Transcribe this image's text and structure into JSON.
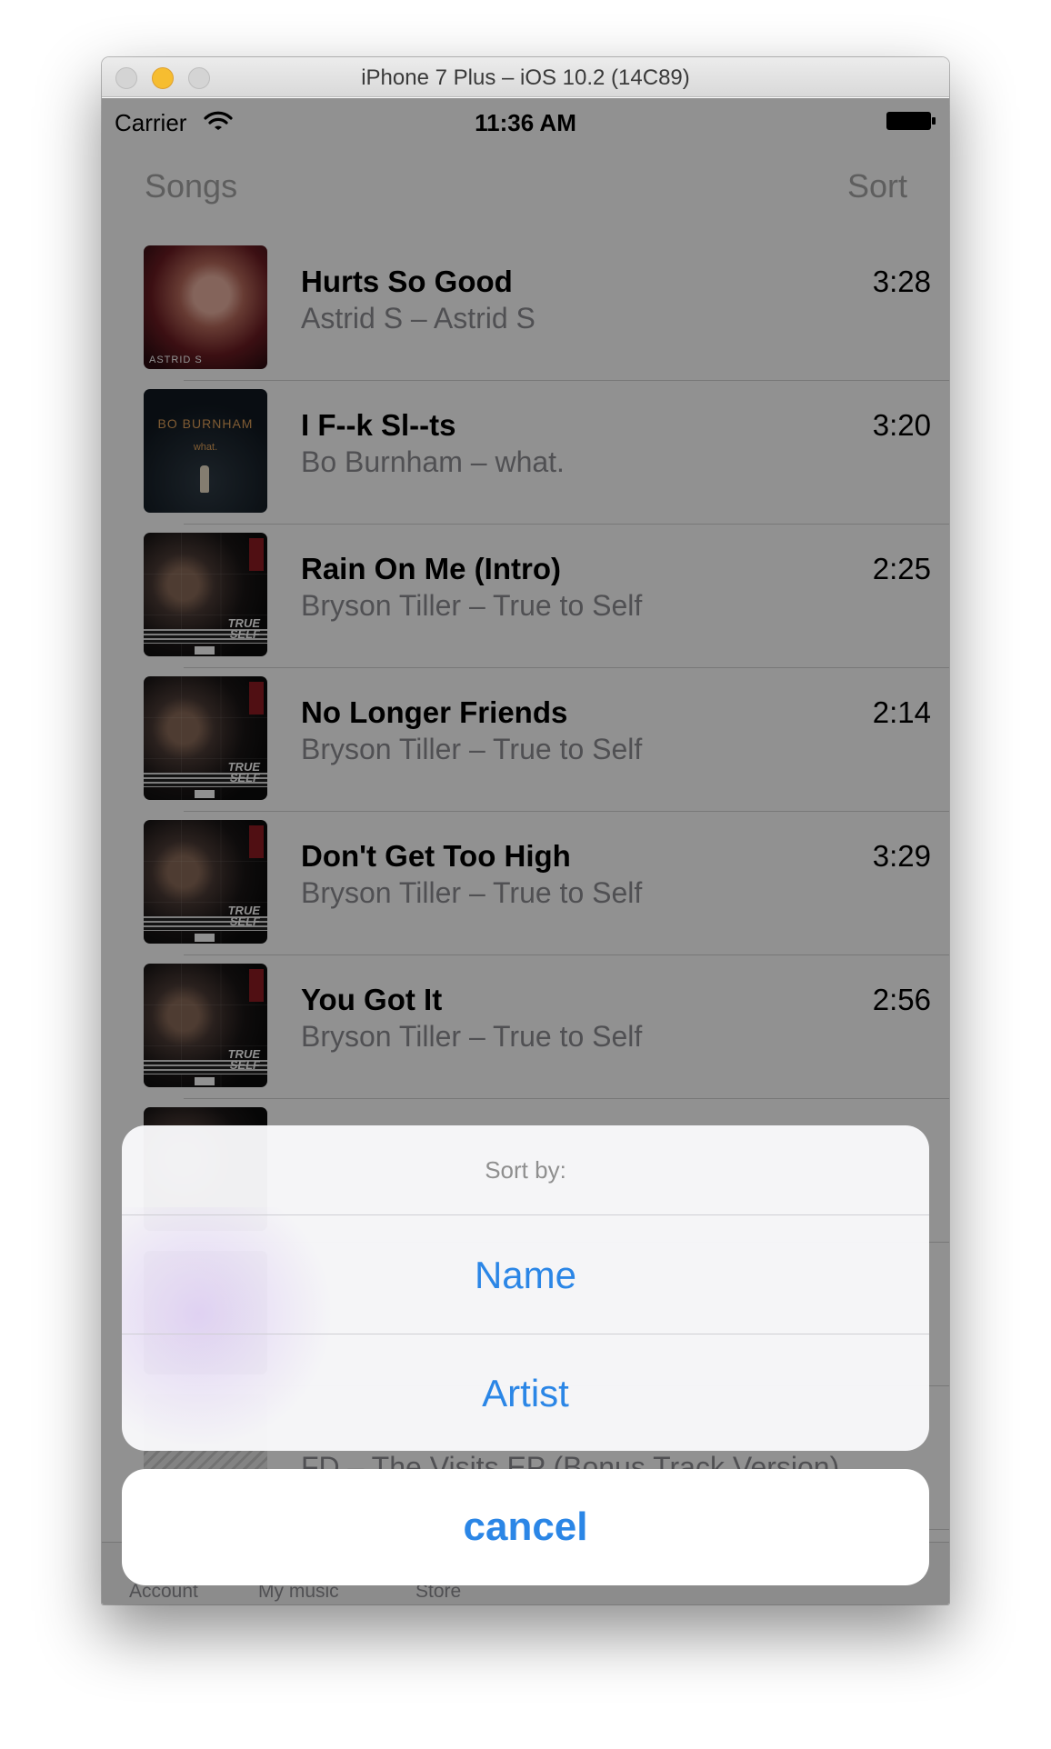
{
  "window": {
    "title": "iPhone 7 Plus – iOS 10.2 (14C89)"
  },
  "status_bar": {
    "carrier": "Carrier",
    "time": "11:36 AM"
  },
  "nav": {
    "title": "Songs",
    "sort": "Sort"
  },
  "songs": [
    {
      "title": "Hurts So Good",
      "subtitle": "Astrid S – Astrid S",
      "duration": "3:28",
      "artwork": "Astrid S album cover",
      "artwork_text": "ASTRID S"
    },
    {
      "title": "I F--k Sl--ts",
      "subtitle": "Bo Burnham – what.",
      "duration": "3:20",
      "artwork": "Bo Burnham what. album cover",
      "artwork_title": "BO BURNHAM",
      "artwork_sub": "what."
    },
    {
      "title": "Rain On Me (Intro)",
      "subtitle": "Bryson Tiller – True to Self",
      "duration": "2:25",
      "artwork": "True to Self album cover",
      "artwork_text": "TRUE\nSELF"
    },
    {
      "title": "No Longer Friends",
      "subtitle": "Bryson Tiller – True to Self",
      "duration": "2:14",
      "artwork": "True to Self album cover",
      "artwork_text": "TRUE\nSELF"
    },
    {
      "title": "Don't Get Too High",
      "subtitle": "Bryson Tiller – True to Self",
      "duration": "3:29",
      "artwork": "True to Self album cover",
      "artwork_text": "TRUE\nSELF"
    },
    {
      "title": "You Got It",
      "subtitle": "Bryson Tiller – True to Self",
      "duration": "2:56",
      "artwork": "True to Self album cover",
      "artwork_text": "TRUE\nSELF"
    }
  ],
  "partial_rows": {
    "last_subtitle": "FD – The Visits EP (Bonus Track Version)"
  },
  "tabs": [
    {
      "label": "Account"
    },
    {
      "label": "My music"
    },
    {
      "label": "Store"
    }
  ],
  "action_sheet": {
    "title": "Sort by:",
    "options": [
      {
        "label": "Name"
      },
      {
        "label": "Artist"
      }
    ],
    "cancel": "cancel"
  },
  "colors": {
    "accent": "#2b86e6",
    "overlay": "rgba(0,0,0,0.43)",
    "secondary_text": "#8e8e93"
  },
  "icons": [
    "wifi-icon",
    "battery-icon"
  ]
}
